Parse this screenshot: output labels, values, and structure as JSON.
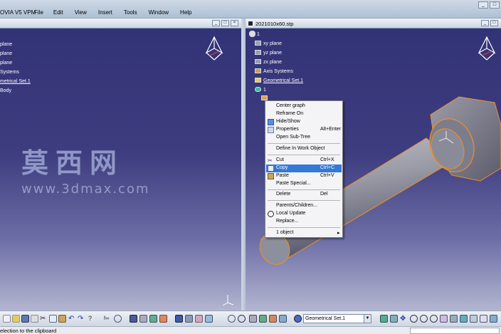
{
  "app": {
    "title_fragment": "OVIA V5 VPM",
    "menu": [
      "File",
      "Edit",
      "View",
      "Insert",
      "Tools",
      "Window",
      "Help"
    ]
  },
  "left_window": {
    "tree": [
      "plane",
      "plane",
      "plane",
      "Systems",
      "metrical Set.1",
      "Body"
    ]
  },
  "right_window": {
    "title": "2021010x60.stp",
    "tree_root": "1",
    "tree": [
      {
        "label": "xy plane",
        "underline": false
      },
      {
        "label": "yz plane",
        "underline": false
      },
      {
        "label": "zx plane",
        "underline": false
      },
      {
        "label": "Axis Systems",
        "underline": false
      },
      {
        "label": "Geometrical Set.1",
        "underline": true
      },
      {
        "label": "1",
        "underline": false
      }
    ]
  },
  "watermark": {
    "chinese": "莫西网",
    "url": "www.3dmax.com"
  },
  "context_menu": {
    "items": [
      {
        "label": "Center graph",
        "shortcut": "",
        "icon": "",
        "highlighted": false
      },
      {
        "label": "Reframe On",
        "shortcut": "",
        "icon": "",
        "highlighted": false
      },
      {
        "label": "Hide/Show",
        "shortcut": "",
        "icon": "hide-show-icon",
        "highlighted": false
      },
      {
        "label": "Properties",
        "shortcut": "Alt+Enter",
        "icon": "properties-icon",
        "highlighted": false
      },
      {
        "label": "Open Sub-Tree",
        "shortcut": "",
        "icon": "",
        "highlighted": false
      },
      {
        "label": "Define In Work Object",
        "shortcut": "",
        "icon": "",
        "highlighted": false
      },
      {
        "label": "Cut",
        "shortcut": "Ctrl+X",
        "icon": "scissors-icon",
        "highlighted": false
      },
      {
        "label": "Copy",
        "shortcut": "Ctrl+C",
        "icon": "copy-icon",
        "highlighted": true
      },
      {
        "label": "Paste",
        "shortcut": "Ctrl+V",
        "icon": "paste-icon",
        "highlighted": false
      },
      {
        "label": "Paste Special...",
        "shortcut": "",
        "icon": "",
        "highlighted": false
      },
      {
        "label": "Delete",
        "shortcut": "Del",
        "icon": "",
        "highlighted": false
      },
      {
        "label": "Parents/Children...",
        "shortcut": "",
        "icon": "",
        "highlighted": false
      },
      {
        "label": "Local Update",
        "shortcut": "",
        "icon": "update-icon",
        "highlighted": false
      },
      {
        "label": "Replace...",
        "shortcut": "",
        "icon": "",
        "highlighted": false
      },
      {
        "label": "1 object",
        "shortcut": "",
        "icon": "",
        "highlighted": false,
        "submenu": true
      }
    ]
  },
  "toolbar": {
    "current_set": "Geometrical Set.1"
  },
  "status": {
    "message": "election to the clipboard"
  },
  "colors": {
    "viewport_top": "#323276",
    "viewport_bottom": "#b3b5d0",
    "highlight": "#3478d8",
    "model_edge": "#f09020"
  }
}
